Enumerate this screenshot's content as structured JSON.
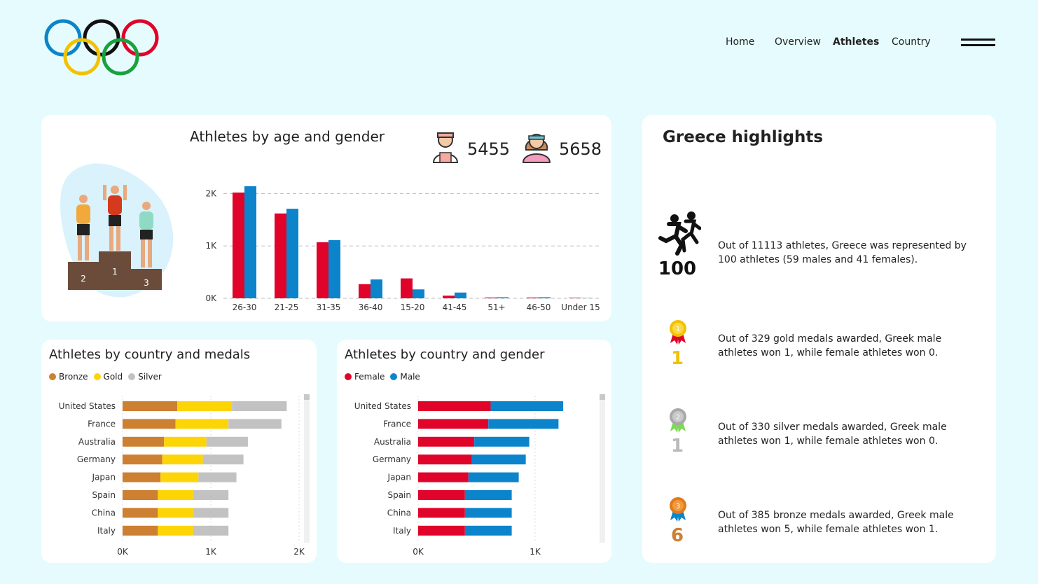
{
  "nav": {
    "items": [
      "Home",
      "Overview",
      "Athletes",
      "Country"
    ],
    "active": "Athletes"
  },
  "age_card": {
    "title": "Athletes by age and gender",
    "male_count": "5455",
    "female_count": "5658",
    "podium_labels": [
      "2",
      "1",
      "3"
    ]
  },
  "medal_card": {
    "title": "Athletes by country and medals",
    "legend": [
      "Bronze",
      "Gold",
      "Silver"
    ]
  },
  "gender_card": {
    "title": "Athletes by country and gender",
    "legend": [
      "Female",
      "Male"
    ]
  },
  "highlights": {
    "title": "Greece highlights",
    "items": [
      {
        "value": "100",
        "text": "Out of 11113 athletes, Greece was represented by 100 athletes (59 males and 41 females).",
        "color": "#111111"
      },
      {
        "value": "1",
        "text": "Out of 329 gold medals awarded, Greek male athletes won 1, while female athletes won 0.",
        "color": "#f2c200"
      },
      {
        "value": "1",
        "text": "Out of 330 silver medals awarded, Greek male athletes won 1, while female athletes won 0.",
        "color": "#b9b9b9"
      },
      {
        "value": "6",
        "text": "Out of 385 bronze medals awarded, Greek male athletes won 5, while female athletes won 1.",
        "color": "#cd7f32"
      }
    ]
  },
  "colors": {
    "female": "#e0042a",
    "male": "#0b84cc",
    "bronze": "#cd7f32",
    "gold": "#fdd507",
    "silver": "#c2c2c2"
  },
  "chart_data": [
    {
      "type": "bar",
      "title": "Athletes by age and gender",
      "categories": [
        "26-30",
        "21-25",
        "31-35",
        "36-40",
        "15-20",
        "41-45",
        "51+",
        "46-50",
        "Under 15"
      ],
      "series": [
        {
          "name": "Female",
          "values": [
            2020,
            1620,
            1070,
            270,
            380,
            50,
            15,
            15,
            10
          ]
        },
        {
          "name": "Male",
          "values": [
            2140,
            1710,
            1110,
            360,
            170,
            110,
            20,
            20,
            5
          ]
        }
      ],
      "yticks": [
        "0K",
        "1K",
        "2K"
      ],
      "ylim": [
        0,
        2300
      ]
    },
    {
      "type": "bar",
      "orientation": "horizontal-stacked",
      "title": "Athletes by country and medals",
      "categories": [
        "United States",
        "France",
        "Australia",
        "Germany",
        "Japan",
        "Spain",
        "China",
        "Italy"
      ],
      "series": [
        {
          "name": "Bronze",
          "values": [
            620,
            600,
            470,
            450,
            430,
            400,
            400,
            400
          ]
        },
        {
          "name": "Gold",
          "values": [
            620,
            600,
            480,
            460,
            430,
            400,
            400,
            400
          ]
        },
        {
          "name": "Silver",
          "values": [
            620,
            600,
            470,
            460,
            430,
            400,
            400,
            400
          ]
        }
      ],
      "xticks": [
        "0K",
        "1K",
        "2K"
      ],
      "xlim": [
        0,
        2000
      ]
    },
    {
      "type": "bar",
      "orientation": "horizontal-stacked",
      "title": "Athletes by country and gender",
      "categories": [
        "United States",
        "France",
        "Australia",
        "Germany",
        "Japan",
        "Spain",
        "China",
        "Italy"
      ],
      "series": [
        {
          "name": "Female",
          "values": [
            620,
            600,
            480,
            460,
            430,
            400,
            400,
            400
          ]
        },
        {
          "name": "Male",
          "values": [
            620,
            600,
            470,
            460,
            430,
            400,
            400,
            400
          ]
        }
      ],
      "xticks": [
        "0K",
        "1K"
      ],
      "xlim": [
        0,
        1000
      ]
    }
  ]
}
